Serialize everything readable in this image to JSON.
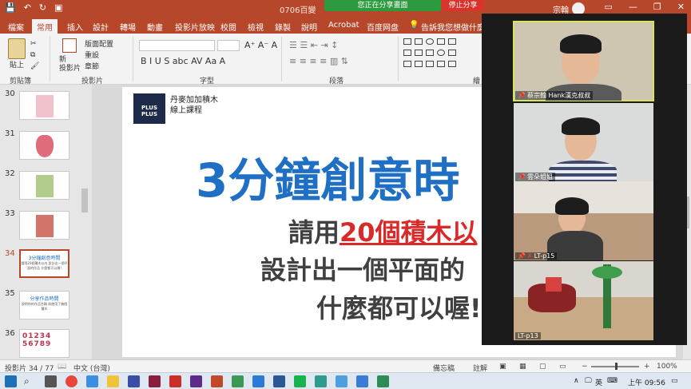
{
  "window": {
    "doc_title": "0706百變",
    "share_status": "您正在分享畫面",
    "stop_share": "停止分享",
    "user_name": "宗翰"
  },
  "ribbon": {
    "tabs": [
      "檔案",
      "常用",
      "插入",
      "設計",
      "轉場",
      "動畫",
      "投影片放映",
      "校閱",
      "檢視",
      "錄製",
      "說明",
      "Acrobat",
      "百度网盘",
      "告訴我您想做什麼"
    ],
    "active_tab": "常用",
    "paste_label": "貼上",
    "new_slide_label": "新\n投影片",
    "layout_label": "版面配置",
    "reset_label": "重設",
    "section_label": "章節",
    "groups": [
      "剪貼簿",
      "投影片",
      "字型",
      "段落",
      "繪"
    ]
  },
  "thumbnails": [
    {
      "num": "30",
      "kind": "art",
      "color": "#e89aa8"
    },
    {
      "num": "31",
      "kind": "art",
      "color": "#d63b4d"
    },
    {
      "num": "32",
      "kind": "art",
      "color": "#8fb85a"
    },
    {
      "num": "33",
      "kind": "art",
      "color": "#c0392b"
    },
    {
      "num": "34",
      "kind": "text",
      "title": "3分鐘創意時間",
      "sub": "請用20個積木以內 設計出一個平面的作品 什麼都可以喔!"
    },
    {
      "num": "35",
      "kind": "text",
      "title": "分享作品時間",
      "sub": "說明你的作品名稱 與使用了幾個積木"
    },
    {
      "num": "36",
      "kind": "digits",
      "title": "01234 56789"
    }
  ],
  "selected_slide": "34",
  "slide": {
    "logo": "PLUS PLUS",
    "brand_line1": "丹麥加加積木",
    "brand_line2": "線上課程",
    "title": "3分鐘創意時",
    "line1_prefix": "請用",
    "line1_red": "20個積木以",
    "line2": "設計出一個平面的",
    "line3": "什麼都可以喔!"
  },
  "statusbar": {
    "slide_count": "投影片 34 / 77",
    "language": "中文 (台灣)",
    "notes": "備忘稿",
    "comments": "註解",
    "zoom": "100%"
  },
  "taskbar": {
    "ime": "英",
    "time": "上午 09:56"
  },
  "zoom_panel": {
    "participants": [
      {
        "name": "蔡宗翰 Hank漢克叔叔",
        "pinned": true,
        "muted": false,
        "speaking": true
      },
      {
        "name": "雲朵姐姐",
        "pinned": true,
        "muted": false,
        "speaking": false
      },
      {
        "name": "LT-p15",
        "pinned": true,
        "muted": true,
        "speaking": false
      },
      {
        "name": "LT-p13",
        "pinned": false,
        "muted": false,
        "speaking": false
      }
    ]
  },
  "colors": {
    "ppt_accent": "#b7472a",
    "title_blue": "#1f6fc5",
    "highlight_red": "#d92a2a",
    "share_green": "#2d9a3f",
    "speaker_outline": "#d7e45a"
  }
}
